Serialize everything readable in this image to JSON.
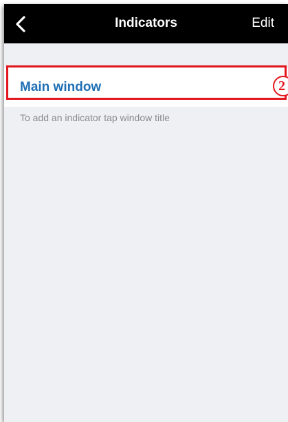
{
  "header": {
    "back_icon": "chevron-left-icon",
    "title": "Indicators",
    "edit_label": "Edit"
  },
  "main": {
    "section_title": "Main window",
    "hint": "To add an indicator tap window title"
  },
  "annotation": {
    "step_number": "2"
  },
  "colors": {
    "navbar_bg": "#000000",
    "page_bg": "#eff0f4",
    "link_blue": "#1f6fb5",
    "hint_gray": "#8a8a8f",
    "annotation_red": "#e3161e"
  }
}
